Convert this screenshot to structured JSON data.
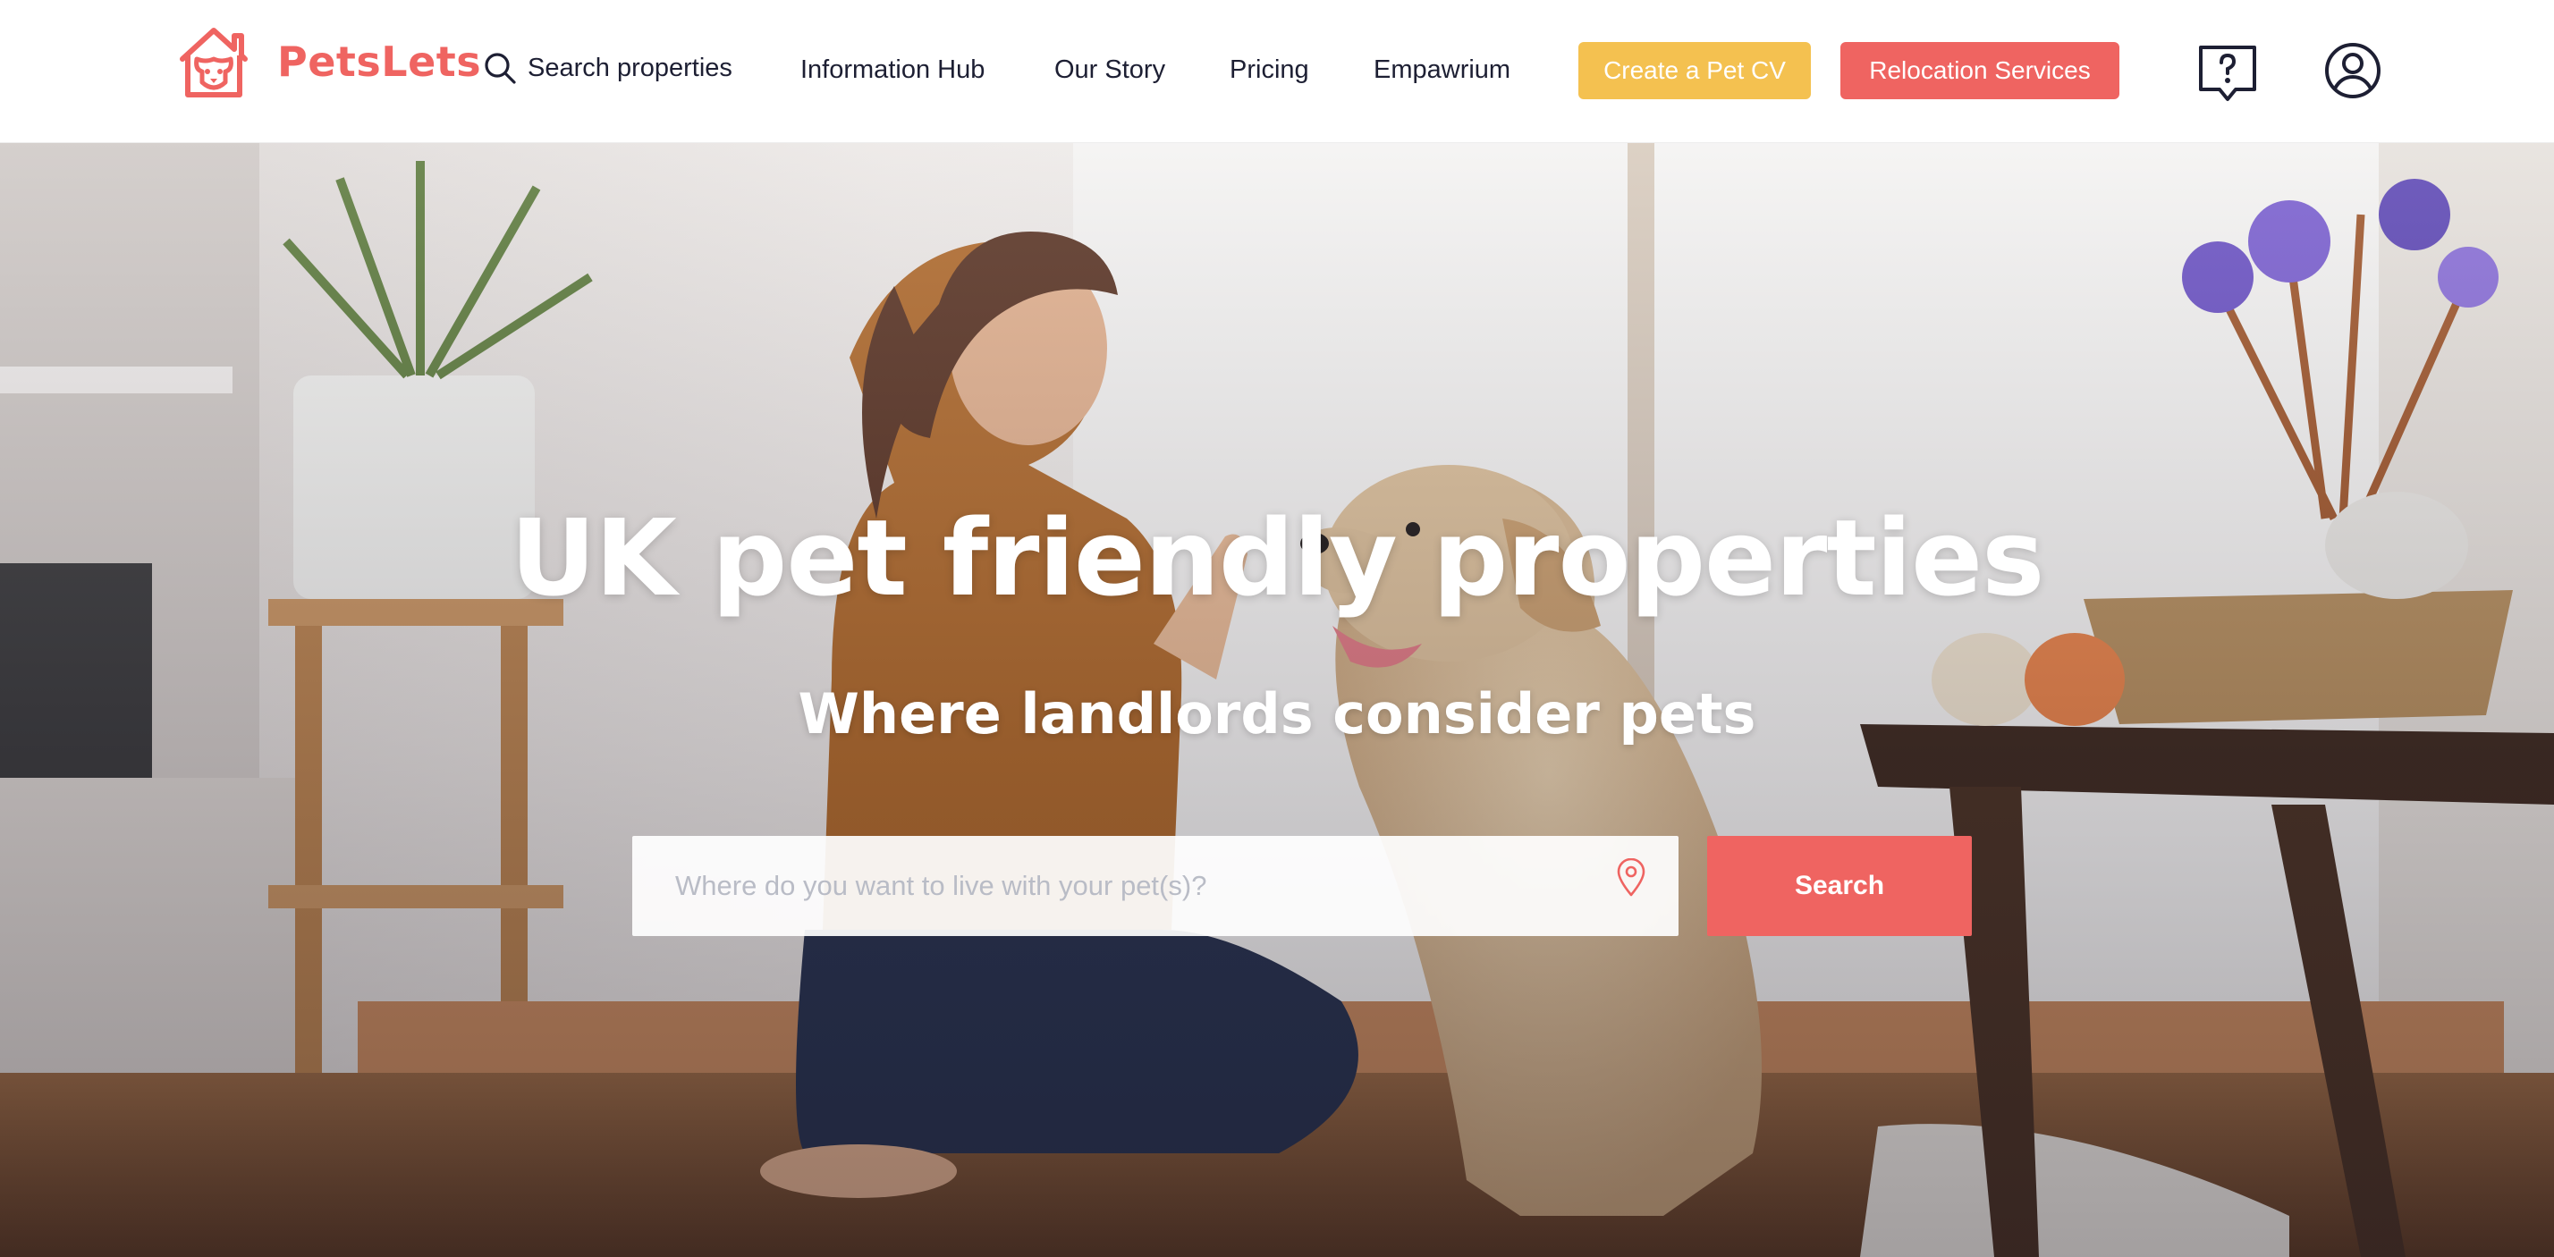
{
  "header": {
    "brand": "PetsLets",
    "nav": {
      "search_properties": "Search properties",
      "information_hub": "Information Hub",
      "our_story": "Our Story",
      "pricing": "Pricing",
      "empawrium": "Empawrium"
    },
    "buttons": {
      "create_pet_cv": "Create a Pet CV",
      "relocation_services": "Relocation Services"
    },
    "icons": [
      "house-dog-logo-icon",
      "search-icon",
      "help-chat-icon",
      "user-account-icon"
    ]
  },
  "hero": {
    "title": "UK pet friendly properties",
    "subtitle": "Where landlords consider pets",
    "search": {
      "placeholder": "Where do you want to live with your pet(s)?",
      "button_label": "Search",
      "icon": "location-pin-icon"
    }
  },
  "colors": {
    "brand": "#ef6461",
    "cv_button": "#f4c150",
    "nav_text": "#1d1f33"
  }
}
